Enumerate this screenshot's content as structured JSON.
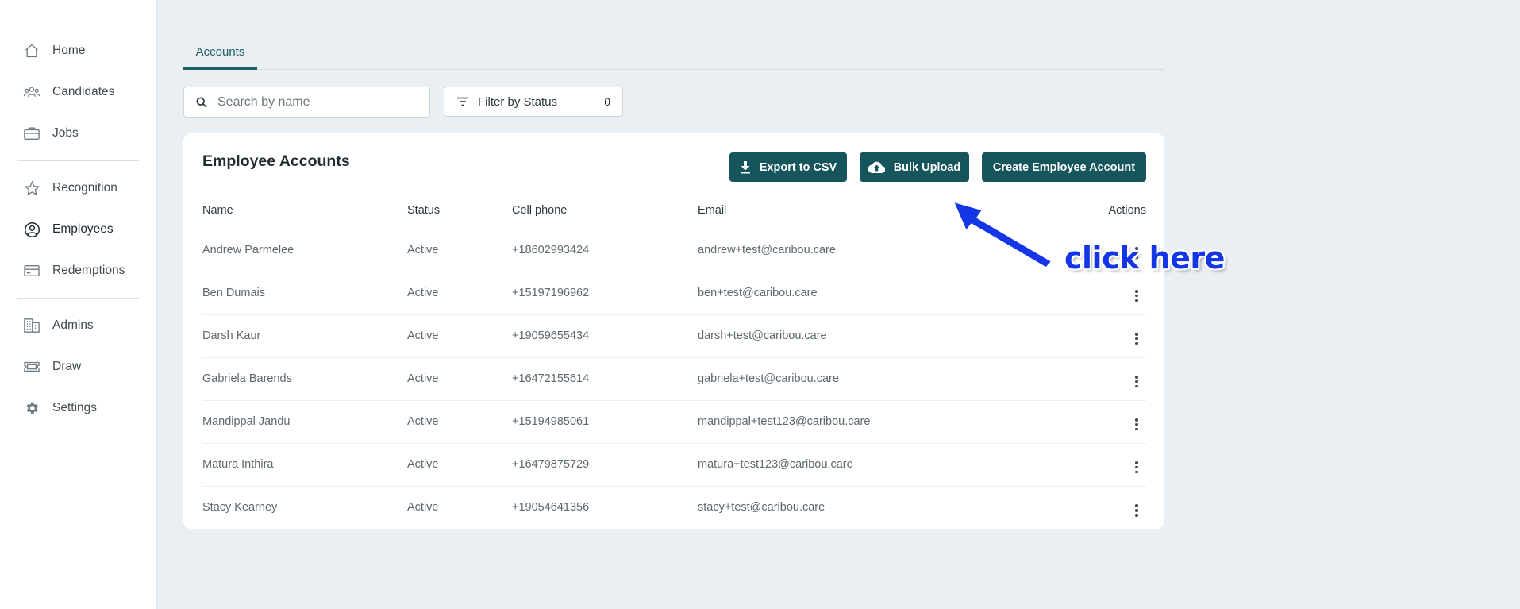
{
  "sidebar": {
    "items": [
      {
        "label": "Home",
        "icon": "home-icon"
      },
      {
        "label": "Candidates",
        "icon": "people-icon"
      },
      {
        "label": "Jobs",
        "icon": "briefcase-icon"
      },
      {
        "label": "Recognition",
        "icon": "star-icon"
      },
      {
        "label": "Employees",
        "icon": "user-circle-icon",
        "active": true
      },
      {
        "label": "Redemptions",
        "icon": "card-icon"
      },
      {
        "label": "Admins",
        "icon": "building-icon"
      },
      {
        "label": "Draw",
        "icon": "ticket-icon"
      },
      {
        "label": "Settings",
        "icon": "gear-icon"
      }
    ]
  },
  "tabs": [
    {
      "label": "Accounts",
      "active": true
    }
  ],
  "search": {
    "placeholder": "Search by name",
    "value": ""
  },
  "filter": {
    "label": "Filter by Status",
    "count": "0"
  },
  "card": {
    "title": "Employee Accounts",
    "buttons": {
      "export": "Export to CSV",
      "bulk": "Bulk Upload",
      "create": "Create Employee Account"
    }
  },
  "table": {
    "headers": [
      "Name",
      "Status",
      "Cell phone",
      "Email",
      "Actions"
    ],
    "rows": [
      {
        "name": "Andrew Parmelee",
        "status": "Active",
        "phone": "+18602993424",
        "email": "andrew+test@caribou.care"
      },
      {
        "name": "Ben Dumais",
        "status": "Active",
        "phone": "+15197196962",
        "email": "ben+test@caribou.care"
      },
      {
        "name": "Darsh Kaur",
        "status": "Active",
        "phone": "+19059655434",
        "email": "darsh+test@caribou.care"
      },
      {
        "name": "Gabriela Barends",
        "status": "Active",
        "phone": "+16472155614",
        "email": "gabriela+test@caribou.care"
      },
      {
        "name": "Mandippal Jandu",
        "status": "Active",
        "phone": "+15194985061",
        "email": "mandippal+test123@caribou.care"
      },
      {
        "name": "Matura Inthira",
        "status": "Active",
        "phone": "+16479875729",
        "email": "matura+test123@caribou.care"
      },
      {
        "name": "Stacy Kearney",
        "status": "Active",
        "phone": "+19054641356",
        "email": "stacy+test@caribou.care"
      }
    ]
  },
  "annotation": {
    "text": "click here",
    "color": "#1436e6"
  },
  "colors": {
    "accent": "#16555c",
    "tab_active": "#1f5f66",
    "background": "#e9eff3"
  }
}
